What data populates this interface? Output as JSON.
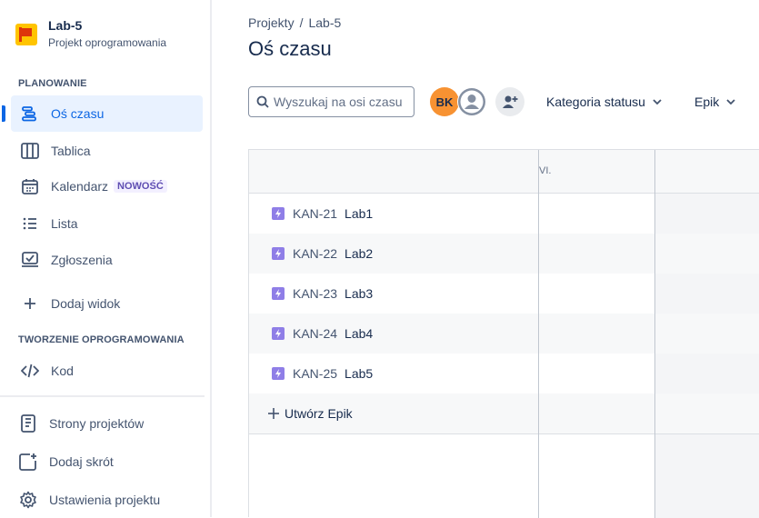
{
  "project": {
    "name": "Lab-5",
    "type": "Projekt oprogramowania"
  },
  "sidebar": {
    "section_planning": "PLANOWANIE",
    "items": [
      {
        "label": "Oś czasu",
        "icon": "timeline-icon",
        "active": true
      },
      {
        "label": "Tablica",
        "icon": "board-icon"
      },
      {
        "label": "Kalendarz",
        "icon": "calendar-icon",
        "badge": "NOWOŚĆ"
      },
      {
        "label": "Lista",
        "icon": "list-icon"
      },
      {
        "label": "Zgłoszenia",
        "icon": "issues-icon"
      },
      {
        "label": "Dodaj widok",
        "icon": "plus-icon"
      }
    ],
    "section_dev": "TWORZENIE OPROGRAMOWANIA",
    "dev_items": [
      {
        "label": "Kod",
        "icon": "code-icon"
      }
    ],
    "bottom_items": [
      {
        "label": "Strony projektów",
        "icon": "page-icon"
      },
      {
        "label": "Dodaj skrót",
        "icon": "add-shortcut-icon"
      },
      {
        "label": "Ustawienia projektu",
        "icon": "gear-icon"
      }
    ]
  },
  "breadcrumb": {
    "root": "Projekty",
    "separator": "/",
    "current": "Lab-5"
  },
  "page_title": "Oś czasu",
  "toolbar": {
    "search_placeholder": "Wyszukaj na osi czasu",
    "avatar_initials": "BK",
    "filter_status": "Kategoria statusu",
    "filter_epic": "Epik"
  },
  "timeline": {
    "month_label": "VI.",
    "epics": [
      {
        "key": "KAN-21",
        "name": "Lab1"
      },
      {
        "key": "KAN-22",
        "name": "Lab2"
      },
      {
        "key": "KAN-23",
        "name": "Lab3"
      },
      {
        "key": "KAN-24",
        "name": "Lab4"
      },
      {
        "key": "KAN-25",
        "name": "Lab5"
      }
    ],
    "create_label": "Utwórz Epik"
  },
  "colors": {
    "accent": "#0c66e4",
    "epic": "#8f7ee7",
    "avatar": "#f79232"
  }
}
